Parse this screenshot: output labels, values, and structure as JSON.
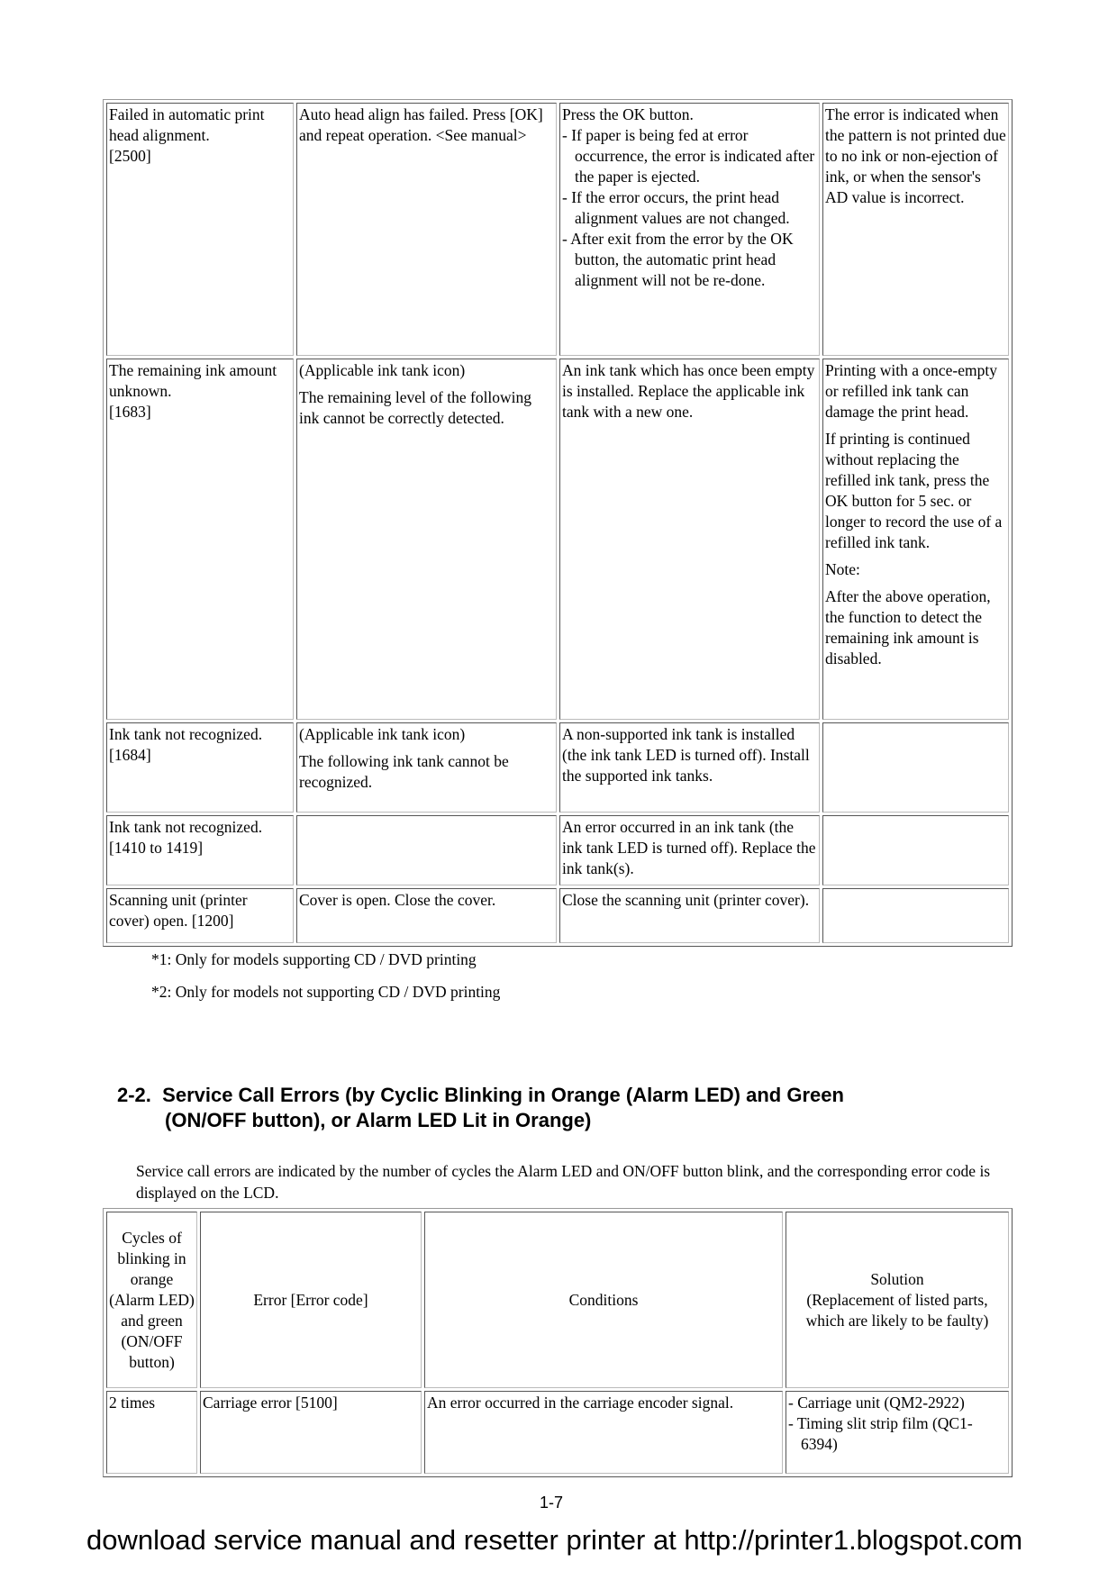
{
  "table1": {
    "rows": [
      {
        "error": [
          "Failed in automatic print head alignment.",
          "[2500]"
        ],
        "message": [
          "Auto head align has failed. Press [OK] and repeat operation. <See manual>"
        ],
        "solution": [
          "Press the OK button.",
          "- If paper is being fed at error occurrence, the error is indicated after the paper is ejected.",
          "- If the error occurs, the print head alignment values are not changed.",
          "- After exit from the error by the OK button, the automatic print head alignment will not be re-done."
        ],
        "remarks": [
          "The error is indicated when the pattern is not printed due to no ink or non-ejection of ink, or when the sensor's AD value is incorrect."
        ]
      },
      {
        "error": [
          "The remaining ink amount unknown.",
          "[1683]"
        ],
        "message": [
          "(Applicable ink tank icon)",
          "The remaining level of the following ink cannot be correctly detected."
        ],
        "solution": [
          "An ink tank which has once been empty is installed. Replace the applicable ink tank with a new one."
        ],
        "remarks": [
          "Printing with a once-empty or refilled ink tank can damage the print head.",
          "If printing is continued without replacing the refilled ink tank, press the OK button for 5 sec. or longer to record the use of a refilled ink tank.",
          "Note:",
          "After the above operation, the function to detect the remaining ink amount is disabled."
        ]
      },
      {
        "error": [
          "Ink tank not recognized.",
          "[1684]"
        ],
        "message": [
          "(Applicable ink tank icon)",
          "The following ink tank cannot be recognized."
        ],
        "solution": [
          "A non-supported ink tank is installed (the ink tank LED is turned off). Install the supported ink tanks."
        ],
        "remarks": []
      },
      {
        "error": [
          "Ink tank not recognized.",
          "[1410 to 1419]"
        ],
        "message": [],
        "solution": [
          "An error occurred in an ink tank (the ink tank LED is turned off). Replace the ink tank(s)."
        ],
        "remarks": []
      },
      {
        "error": [
          "Scanning unit (printer cover) open. [1200]"
        ],
        "message": [
          "Cover is open. Close the cover."
        ],
        "solution": [
          "Close the scanning unit (printer cover)."
        ],
        "remarks": []
      }
    ]
  },
  "footnotes": [
    "*1:  Only for models supporting CD / DVD printing",
    "*2:  Only for models not supporting CD / DVD printing"
  ],
  "section": {
    "number": "2-2.",
    "title_line1": "Service Call Errors (by Cyclic Blinking in Orange (Alarm LED) and Green",
    "title_line2": "(ON/OFF button), or Alarm LED Lit in Orange)",
    "intro": "Service call errors are indicated by the number of cycles the Alarm LED and ON/OFF button blink, and the corresponding error code is displayed on the LCD."
  },
  "table2": {
    "headers": [
      "Cycles of blinking in orange (Alarm LED) and green (ON/OFF button)",
      "Error [Error code]",
      "Conditions",
      "Solution",
      "(Replacement of listed parts, which are likely to be faulty)"
    ],
    "rows": [
      {
        "cycles": "2 times",
        "error": "Carriage error [5100]",
        "conditions": "An error occurred in the carriage encoder signal.",
        "solution": [
          "- Carriage unit (QM2-2922)",
          "- Timing slit strip film (QC1-6394)"
        ]
      }
    ]
  },
  "page_number": "1-7",
  "banner": "download service manual and resetter printer at http://printer1.blogspot.com"
}
